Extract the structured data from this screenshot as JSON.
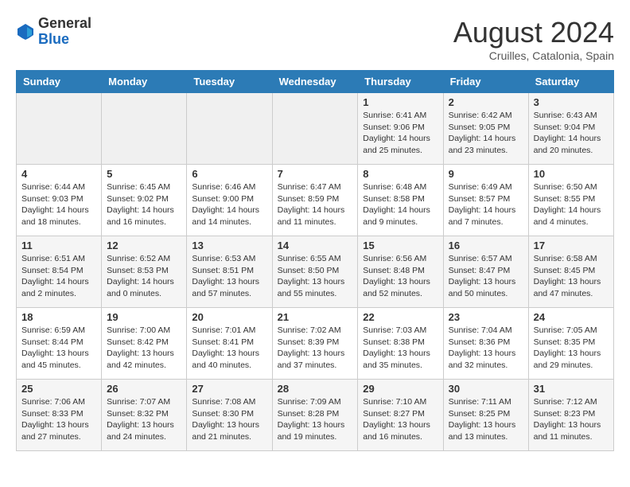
{
  "header": {
    "logo_general": "General",
    "logo_blue": "Blue",
    "month_year": "August 2024",
    "location": "Cruilles, Catalonia, Spain"
  },
  "weekdays": [
    "Sunday",
    "Monday",
    "Tuesday",
    "Wednesday",
    "Thursday",
    "Friday",
    "Saturday"
  ],
  "weeks": [
    [
      {
        "day": "",
        "info": ""
      },
      {
        "day": "",
        "info": ""
      },
      {
        "day": "",
        "info": ""
      },
      {
        "day": "",
        "info": ""
      },
      {
        "day": "1",
        "info": "Sunrise: 6:41 AM\nSunset: 9:06 PM\nDaylight: 14 hours\nand 25 minutes."
      },
      {
        "day": "2",
        "info": "Sunrise: 6:42 AM\nSunset: 9:05 PM\nDaylight: 14 hours\nand 23 minutes."
      },
      {
        "day": "3",
        "info": "Sunrise: 6:43 AM\nSunset: 9:04 PM\nDaylight: 14 hours\nand 20 minutes."
      }
    ],
    [
      {
        "day": "4",
        "info": "Sunrise: 6:44 AM\nSunset: 9:03 PM\nDaylight: 14 hours\nand 18 minutes."
      },
      {
        "day": "5",
        "info": "Sunrise: 6:45 AM\nSunset: 9:02 PM\nDaylight: 14 hours\nand 16 minutes."
      },
      {
        "day": "6",
        "info": "Sunrise: 6:46 AM\nSunset: 9:00 PM\nDaylight: 14 hours\nand 14 minutes."
      },
      {
        "day": "7",
        "info": "Sunrise: 6:47 AM\nSunset: 8:59 PM\nDaylight: 14 hours\nand 11 minutes."
      },
      {
        "day": "8",
        "info": "Sunrise: 6:48 AM\nSunset: 8:58 PM\nDaylight: 14 hours\nand 9 minutes."
      },
      {
        "day": "9",
        "info": "Sunrise: 6:49 AM\nSunset: 8:57 PM\nDaylight: 14 hours\nand 7 minutes."
      },
      {
        "day": "10",
        "info": "Sunrise: 6:50 AM\nSunset: 8:55 PM\nDaylight: 14 hours\nand 4 minutes."
      }
    ],
    [
      {
        "day": "11",
        "info": "Sunrise: 6:51 AM\nSunset: 8:54 PM\nDaylight: 14 hours\nand 2 minutes."
      },
      {
        "day": "12",
        "info": "Sunrise: 6:52 AM\nSunset: 8:53 PM\nDaylight: 14 hours\nand 0 minutes."
      },
      {
        "day": "13",
        "info": "Sunrise: 6:53 AM\nSunset: 8:51 PM\nDaylight: 13 hours\nand 57 minutes."
      },
      {
        "day": "14",
        "info": "Sunrise: 6:55 AM\nSunset: 8:50 PM\nDaylight: 13 hours\nand 55 minutes."
      },
      {
        "day": "15",
        "info": "Sunrise: 6:56 AM\nSunset: 8:48 PM\nDaylight: 13 hours\nand 52 minutes."
      },
      {
        "day": "16",
        "info": "Sunrise: 6:57 AM\nSunset: 8:47 PM\nDaylight: 13 hours\nand 50 minutes."
      },
      {
        "day": "17",
        "info": "Sunrise: 6:58 AM\nSunset: 8:45 PM\nDaylight: 13 hours\nand 47 minutes."
      }
    ],
    [
      {
        "day": "18",
        "info": "Sunrise: 6:59 AM\nSunset: 8:44 PM\nDaylight: 13 hours\nand 45 minutes."
      },
      {
        "day": "19",
        "info": "Sunrise: 7:00 AM\nSunset: 8:42 PM\nDaylight: 13 hours\nand 42 minutes."
      },
      {
        "day": "20",
        "info": "Sunrise: 7:01 AM\nSunset: 8:41 PM\nDaylight: 13 hours\nand 40 minutes."
      },
      {
        "day": "21",
        "info": "Sunrise: 7:02 AM\nSunset: 8:39 PM\nDaylight: 13 hours\nand 37 minutes."
      },
      {
        "day": "22",
        "info": "Sunrise: 7:03 AM\nSunset: 8:38 PM\nDaylight: 13 hours\nand 35 minutes."
      },
      {
        "day": "23",
        "info": "Sunrise: 7:04 AM\nSunset: 8:36 PM\nDaylight: 13 hours\nand 32 minutes."
      },
      {
        "day": "24",
        "info": "Sunrise: 7:05 AM\nSunset: 8:35 PM\nDaylight: 13 hours\nand 29 minutes."
      }
    ],
    [
      {
        "day": "25",
        "info": "Sunrise: 7:06 AM\nSunset: 8:33 PM\nDaylight: 13 hours\nand 27 minutes."
      },
      {
        "day": "26",
        "info": "Sunrise: 7:07 AM\nSunset: 8:32 PM\nDaylight: 13 hours\nand 24 minutes."
      },
      {
        "day": "27",
        "info": "Sunrise: 7:08 AM\nSunset: 8:30 PM\nDaylight: 13 hours\nand 21 minutes."
      },
      {
        "day": "28",
        "info": "Sunrise: 7:09 AM\nSunset: 8:28 PM\nDaylight: 13 hours\nand 19 minutes."
      },
      {
        "day": "29",
        "info": "Sunrise: 7:10 AM\nSunset: 8:27 PM\nDaylight: 13 hours\nand 16 minutes."
      },
      {
        "day": "30",
        "info": "Sunrise: 7:11 AM\nSunset: 8:25 PM\nDaylight: 13 hours\nand 13 minutes."
      },
      {
        "day": "31",
        "info": "Sunrise: 7:12 AM\nSunset: 8:23 PM\nDaylight: 13 hours\nand 11 minutes."
      }
    ]
  ]
}
